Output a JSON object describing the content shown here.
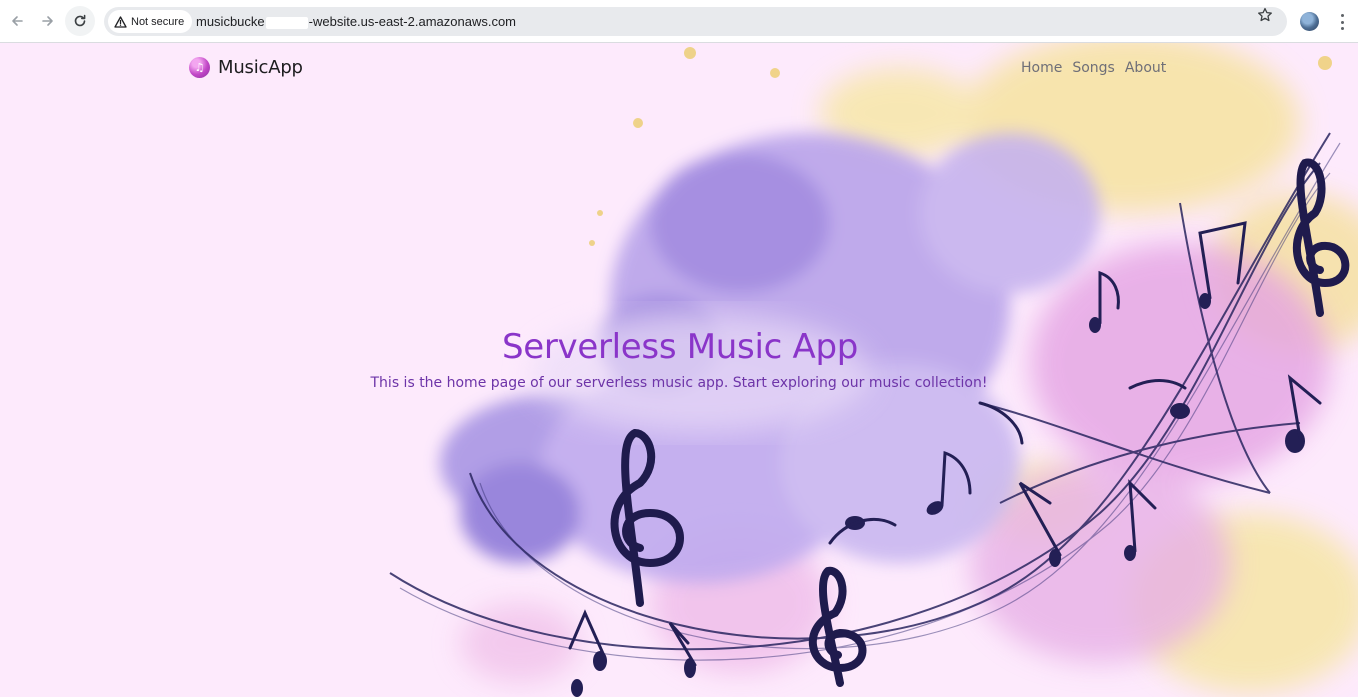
{
  "browser": {
    "security_label": "Not secure",
    "url_prefix": "musicbucke",
    "url_suffix": "-website.us-east-2.amazonaws.com",
    "icons": {
      "back": "arrow-left-icon",
      "forward": "arrow-right-icon",
      "reload": "reload-icon",
      "security": "warning-triangle-icon",
      "bookmark": "star-icon",
      "profile": "avatar",
      "menu": "kebab-menu-icon"
    }
  },
  "app": {
    "brand_name": "MusicApp",
    "brand_icon": "music-note-icon",
    "nav": [
      {
        "label": "Home"
      },
      {
        "label": "Songs"
      },
      {
        "label": "About"
      }
    ]
  },
  "hero": {
    "title": "Serverless Music App",
    "subtitle": "This is the home page of our serverless music app. Start exploring our music collection!"
  },
  "colors": {
    "page_bg": "#fdeafc",
    "title": "#8a35c9",
    "subtitle": "#6d34a8",
    "nav_link": "#6f6f78",
    "splash_purple": "#a58ee6",
    "splash_yellow": "#f6e6a0",
    "splash_pink": "#e7a6e6",
    "notes": "#1f1b4d"
  }
}
